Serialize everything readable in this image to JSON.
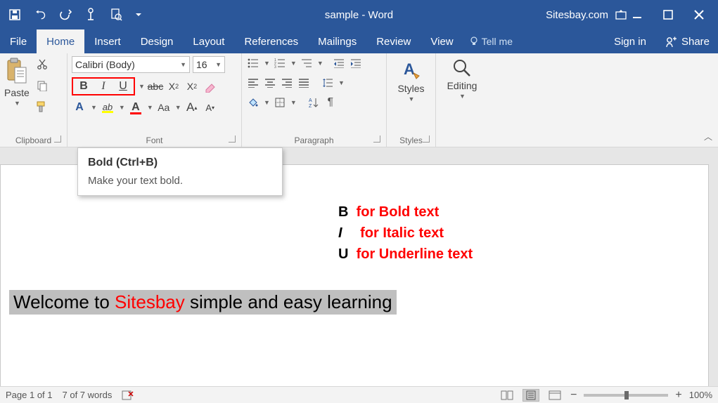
{
  "titlebar": {
    "doc_title": "sample - Word",
    "site_label": "Sitesbay.com"
  },
  "tabs": {
    "file": "File",
    "home": "Home",
    "insert": "Insert",
    "design": "Design",
    "layout": "Layout",
    "references": "References",
    "mailings": "Mailings",
    "review": "Review",
    "view": "View",
    "tell_me": "Tell me",
    "sign_in": "Sign in",
    "share": "Share"
  },
  "ribbon": {
    "clipboard": {
      "paste": "Paste",
      "label": "Clipboard"
    },
    "font": {
      "name": "Calibri (Body)",
      "size": "16",
      "label": "Font"
    },
    "paragraph": {
      "label": "Paragraph"
    },
    "styles": {
      "btn": "Styles",
      "label": "Styles"
    },
    "editing": {
      "btn": "Editing"
    }
  },
  "tooltip": {
    "title": "Bold (Ctrl+B)",
    "body": "Make your text bold."
  },
  "legend": {
    "b_key": "B",
    "b_desc": "for Bold text",
    "i_key": "I",
    "i_desc": "for Italic text",
    "u_key": "U",
    "u_desc": "for Underline text"
  },
  "document": {
    "line_pre": "Welcome to ",
    "line_hl": "Sitesbay",
    "line_post": " simple and easy learning"
  },
  "status": {
    "page": "Page 1 of 1",
    "words": "7 of 7 words",
    "zoom": "100%"
  }
}
